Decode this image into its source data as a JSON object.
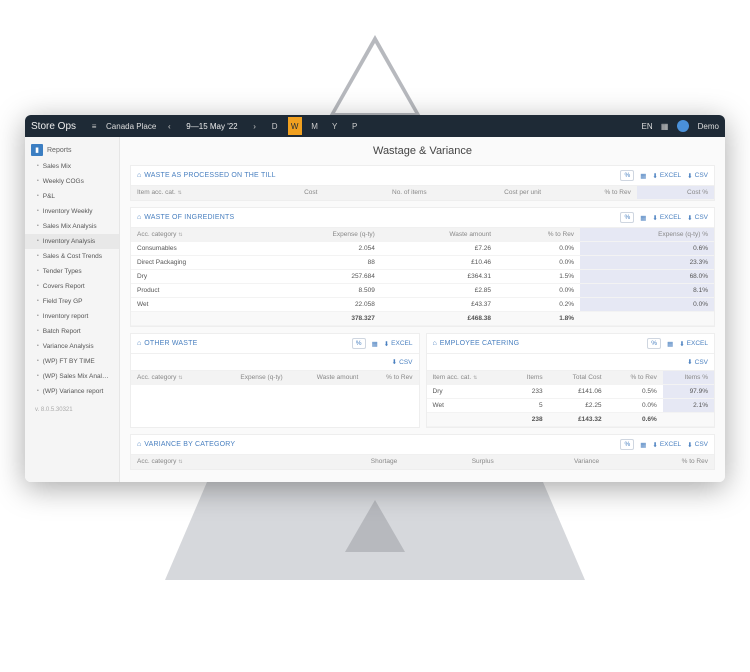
{
  "header": {
    "brand": "Store Ops",
    "location": "Canada Place",
    "date_range": "9—15 May '22",
    "periods": [
      "D",
      "W",
      "M",
      "Y",
      "P"
    ],
    "active_period": "W",
    "lang": "EN",
    "user": "Demo"
  },
  "sidebar": {
    "heading": "Reports",
    "items": [
      "Sales Mix",
      "Weekly COGs",
      "P&L",
      "Inventory Weekly",
      "Sales Mix Analysis",
      "Inventory Analysis",
      "Sales & Cost Trends",
      "Tender Types",
      "Covers Report",
      "Field Trey GP",
      "Inventory report",
      "Batch Report",
      "Variance Analysis",
      "(WP) FT BY TIME",
      "(WP) Sales Mix Analysis",
      "(WP) Variance report"
    ],
    "selected_index": 5,
    "version": "v. 8.0.5.30321"
  },
  "page": {
    "title": "Wastage & Variance"
  },
  "export": {
    "percent": "%",
    "grid": "▦",
    "excel": "EXCEL",
    "csv": "CSV"
  },
  "till": {
    "title": "WASTE AS PROCESSED ON THE TILL",
    "cols": [
      "Item acc. cat.",
      "Cost",
      "No. of items",
      "Cost per unit",
      "% to Rev",
      "Cost %"
    ]
  },
  "ingredients": {
    "title": "WASTE OF INGREDIENTS",
    "cols": [
      "Acc. category",
      "Expense (q-ty)",
      "Waste amount",
      "% to Rev",
      "Expense (q-ty) %"
    ],
    "rows": [
      {
        "cat": "Consumables",
        "exp": "2.054",
        "amt": "£7.26",
        "rev": "0.0%",
        "pct": "0.6%"
      },
      {
        "cat": "Direct Packaging",
        "exp": "88",
        "amt": "£10.46",
        "rev": "0.0%",
        "pct": "23.3%"
      },
      {
        "cat": "Dry",
        "exp": "257.684",
        "amt": "£364.31",
        "rev": "1.5%",
        "pct": "68.0%"
      },
      {
        "cat": "Product",
        "exp": "8.509",
        "amt": "£2.85",
        "rev": "0.0%",
        "pct": "8.1%"
      },
      {
        "cat": "Wet",
        "exp": "22.058",
        "amt": "£43.37",
        "rev": "0.2%",
        "pct": "0.0%"
      }
    ],
    "total": {
      "exp": "378.327",
      "amt": "£468.38",
      "rev": "1.8%"
    }
  },
  "other": {
    "title": "OTHER WASTE",
    "cols": [
      "Acc. category",
      "Expense (q-ty)",
      "Waste amount",
      "% to Rev"
    ]
  },
  "catering": {
    "title": "EMPLOYEE CATERING",
    "cols": [
      "Item acc. cat.",
      "Items",
      "Total Cost",
      "% to Rev",
      "Items %"
    ],
    "rows": [
      {
        "cat": "Dry",
        "items": "233",
        "cost": "£141.06",
        "rev": "0.5%",
        "pct": "97.9%"
      },
      {
        "cat": "Wet",
        "items": "5",
        "cost": "£2.25",
        "rev": "0.0%",
        "pct": "2.1%"
      }
    ],
    "total": {
      "items": "238",
      "cost": "£143.32",
      "rev": "0.6%"
    }
  },
  "variance": {
    "title": "VARIANCE BY CATEGORY",
    "cols": [
      "Acc. category",
      "Shortage",
      "Surplus",
      "Variance",
      "% to Rev"
    ]
  }
}
